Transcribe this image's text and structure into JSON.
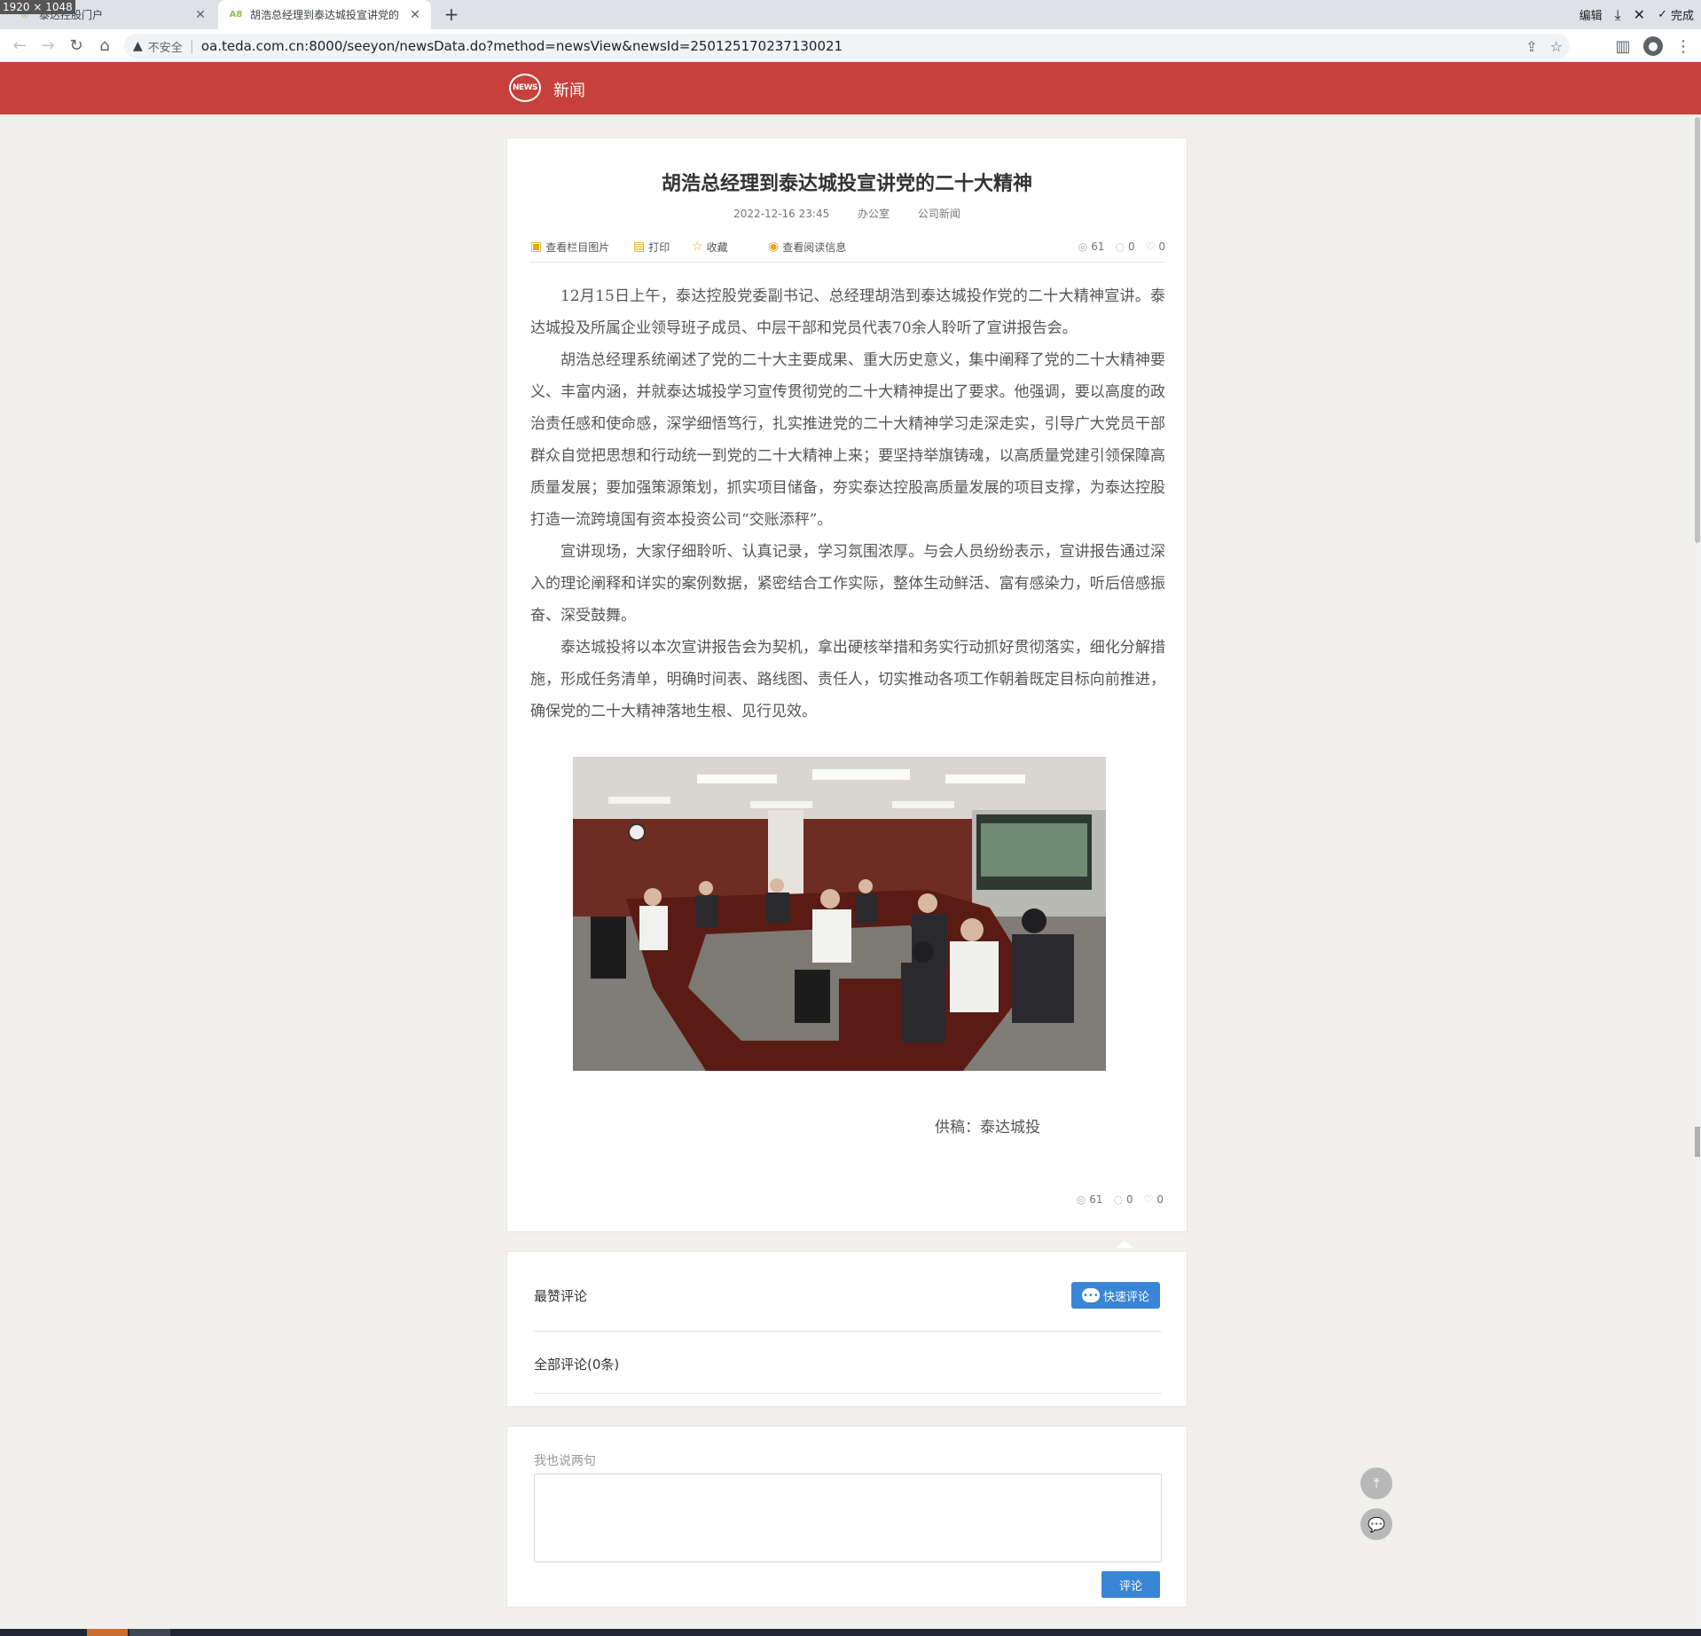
{
  "overlay": {
    "dimensions": "1920 × 1048"
  },
  "browser": {
    "tabs": [
      {
        "title": "泰达控股门户",
        "active": false
      },
      {
        "title": "胡浩总经理到泰达城投宣讲党的二",
        "active": true
      }
    ],
    "top_right": {
      "edit": "编辑",
      "done": "完成"
    },
    "security_label": "不安全",
    "url": "oa.teda.com.cn:8000/seeyon/newsData.do?method=newsView&newsId=250125170237130021"
  },
  "site": {
    "logo_text": "NEWS",
    "title": "新闻"
  },
  "article": {
    "title": "胡浩总经理到泰达城投宣讲党的二十大精神",
    "datetime": "2022-12-16 23:45",
    "department": "办公室",
    "category": "公司新闻",
    "tools": {
      "view_images": "查看栏目图片",
      "print": "打印",
      "favorite": "收藏",
      "read_info": "查看阅读信息"
    },
    "stats": {
      "views": "61",
      "comments": "0",
      "likes": "0"
    },
    "paragraphs": [
      "12月15日上午，泰达控股党委副书记、总经理胡浩到泰达城投作党的二十大精神宣讲。泰达城投及所属企业领导班子成员、中层干部和党员代表70余人聆听了宣讲报告会。",
      "胡浩总经理系统阐述了党的二十大主要成果、重大历史意义，集中阐释了党的二十大精神要义、丰富内涵，并就泰达城投学习宣传贯彻党的二十大精神提出了要求。他强调，要以高度的政治责任感和使命感，深学细悟笃行，扎实推进党的二十大精神学习走深走实，引导广大党员干部群众自觉把思想和行动统一到党的二十大精神上来；要坚持举旗铸魂，以高质量党建引领保障高质量发展；要加强策源策划，抓实项目储备，夯实泰达控股高质量发展的项目支撑，为泰达控股打造一流跨境国有资本投资公司“交账添秤”。",
      "宣讲现场，大家仔细聆听、认真记录，学习氛围浓厚。与会人员纷纷表示，宣讲报告通过深入的理论阐释和详实的案例数据，紧密结合工作实际，整体生动鲜活、富有感染力，听后倍感振奋、深受鼓舞。",
      "泰达城投将以本次宣讲报告会为契机，拿出硬核举措和务实行动抓好贯彻落实，细化分解措施，形成任务清单，明确时间表、路线图、责任人，切实推动各项工作朝着既定目标向前推进，确保党的二十大精神落地生根、见行见效。"
    ],
    "credit": "供稿：泰达城投"
  },
  "comments": {
    "top_label": "最赞评论",
    "quick_comment": "快速评论",
    "all_label": "全部评论(0条)"
  },
  "reply": {
    "label": "我也说两句",
    "submit": "评论"
  }
}
